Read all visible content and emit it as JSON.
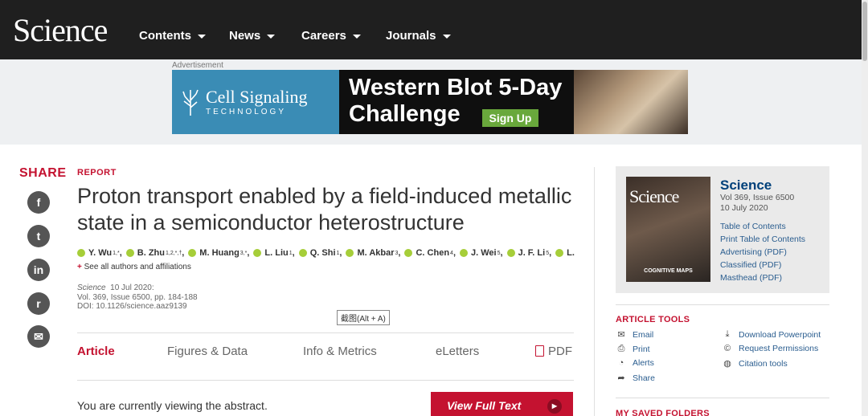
{
  "header": {
    "logo": "Science",
    "nav": [
      "Contents",
      "News",
      "Careers",
      "Journals"
    ]
  },
  "ad": {
    "label": "Advertisement",
    "brand": "Cell Signaling",
    "brand_sub": "TECHNOLOGY",
    "headline_1": "Western Blot 5-Day",
    "headline_2": "Challenge",
    "cta": "Sign Up"
  },
  "share": {
    "title": "SHARE",
    "buttons": [
      {
        "name": "facebook",
        "glyph": "f"
      },
      {
        "name": "twitter",
        "glyph": "t"
      },
      {
        "name": "linkedin",
        "glyph": "in"
      },
      {
        "name": "reddit",
        "glyph": "r"
      },
      {
        "name": "email",
        "glyph": "✉"
      }
    ]
  },
  "article": {
    "kicker": "REPORT",
    "title": "Proton transport enabled by a field-induced metallic state in a semiconductor heterostructure",
    "authors": [
      {
        "name": "Y. Wu",
        "sup": "1,*"
      },
      {
        "name": "B. Zhu",
        "sup": "1,2,*,†"
      },
      {
        "name": "M. Huang",
        "sup": "3,*"
      },
      {
        "name": "L. Liu",
        "sup": "1"
      },
      {
        "name": "Q. Shi",
        "sup": "1"
      },
      {
        "name": "M. Akbar",
        "sup": "3"
      },
      {
        "name": "C. Chen",
        "sup": "4"
      },
      {
        "name": "J. Wei",
        "sup": "5"
      },
      {
        "name": "J. F. Li",
        "sup": "5"
      },
      {
        "name": "L. R...",
        "sup": ""
      }
    ],
    "see_all": "See all authors and affiliations",
    "journal": "Science",
    "date": "10 Jul 2020:",
    "volume": "Vol. 369, Issue 6500, pp. 184-188",
    "doi": "DOI: 10.1126/science.aaz9139",
    "tabs": [
      "Article",
      "Figures & Data",
      "Info & Metrics",
      "eLetters",
      "PDF"
    ],
    "abstract_note": "You are currently viewing the abstract.",
    "full_text": "View Full Text"
  },
  "tooltip": "截图(Alt + A)",
  "issue": {
    "title": "Science",
    "vol": "Vol 369, Issue 6500",
    "date": "10 July 2020",
    "cover_logo": "Science",
    "cover_caption": "COGNITIVE MAPS",
    "links": [
      "Table of Contents",
      "Print Table of Contents",
      "Advertising (PDF)",
      "Classified (PDF)",
      "Masthead (PDF)"
    ]
  },
  "tools": {
    "title": "ARTICLE TOOLS",
    "left": [
      {
        "label": "Email",
        "icon": "envelope-icon"
      },
      {
        "label": "Print",
        "icon": "printer-icon"
      },
      {
        "label": "Alerts",
        "icon": "bell-icon"
      },
      {
        "label": "Share",
        "icon": "share-arrow-icon"
      }
    ],
    "right": [
      {
        "label": "Download Powerpoint",
        "icon": "download-icon"
      },
      {
        "label": "Request Permissions",
        "icon": "copyright-icon"
      },
      {
        "label": "Citation tools",
        "icon": "globe-icon"
      }
    ]
  },
  "saved_folders": "MY SAVED FOLDERS",
  "colors": {
    "accent": "#c41230",
    "nav_bg": "#1f1f1f",
    "link": "#2a5d8f",
    "issue_title": "#00407a"
  }
}
